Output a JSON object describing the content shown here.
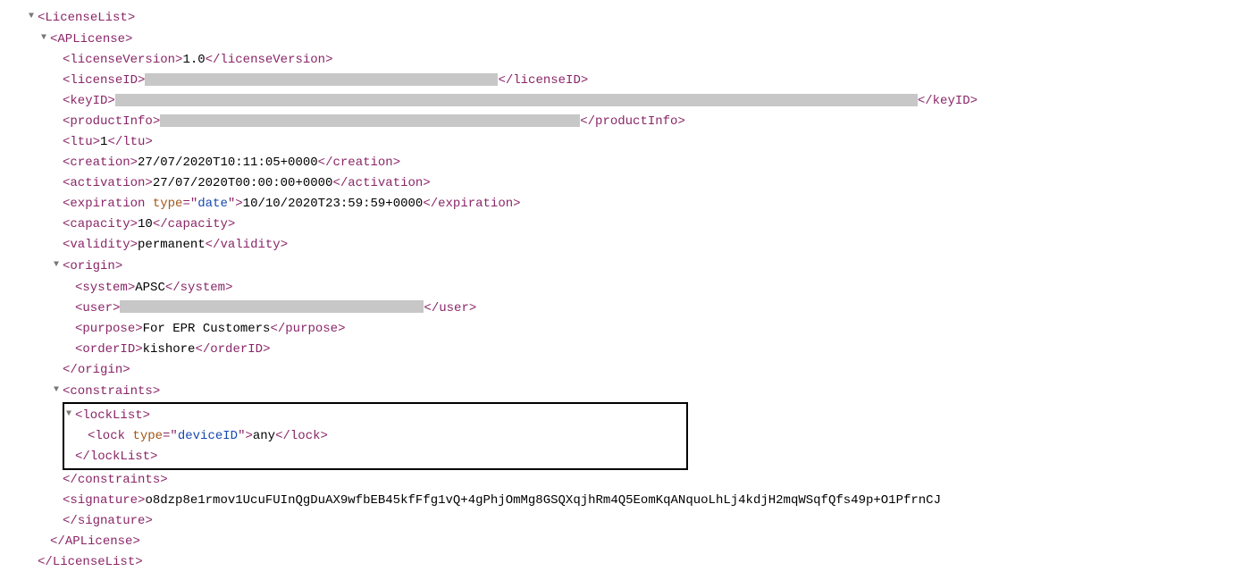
{
  "tags": {
    "LicenseList": "LicenseList",
    "APLicense": "APLicense",
    "licenseVersion": "licenseVersion",
    "licenseID": "licenseID",
    "keyID": "keyID",
    "productInfo": "productInfo",
    "ltu": "ltu",
    "creation": "creation",
    "activation": "activation",
    "expiration": "expiration",
    "capacity": "capacity",
    "validity": "validity",
    "origin": "origin",
    "system": "system",
    "user": "user",
    "purpose": "purpose",
    "orderID": "orderID",
    "constraints": "constraints",
    "lockList": "lockList",
    "lock": "lock",
    "signature": "signature"
  },
  "attrs": {
    "type": "type",
    "date": "date",
    "deviceID": "deviceID"
  },
  "values": {
    "licenseVersion": "1.0",
    "ltu": "1",
    "creation": "27/07/2020T10:11:05+0000",
    "activation": "27/07/2020T00:00:00+0000",
    "expiration": "10/10/2020T23:59:59+0000",
    "capacity": "10",
    "validity": "permanent",
    "system": "APSC",
    "purpose": "For EPR Customers",
    "orderID": "kishore",
    "lock": "any",
    "signature": "o8dzp8e1rmov1UcuFUInQgDuAX9wfbEB45kfFfg1vQ+4gPhjOmMg8GSQXqjhRm4Q5EomKqANquoLhLj4kdjH2mqWSqfQfs49p+O1PfrnCJ"
  },
  "redacted": {
    "licenseID_width": 395,
    "keyID_width": 898,
    "productInfo_width": 470,
    "user_width": 340
  },
  "glyphs": {
    "collapse": "▼"
  }
}
